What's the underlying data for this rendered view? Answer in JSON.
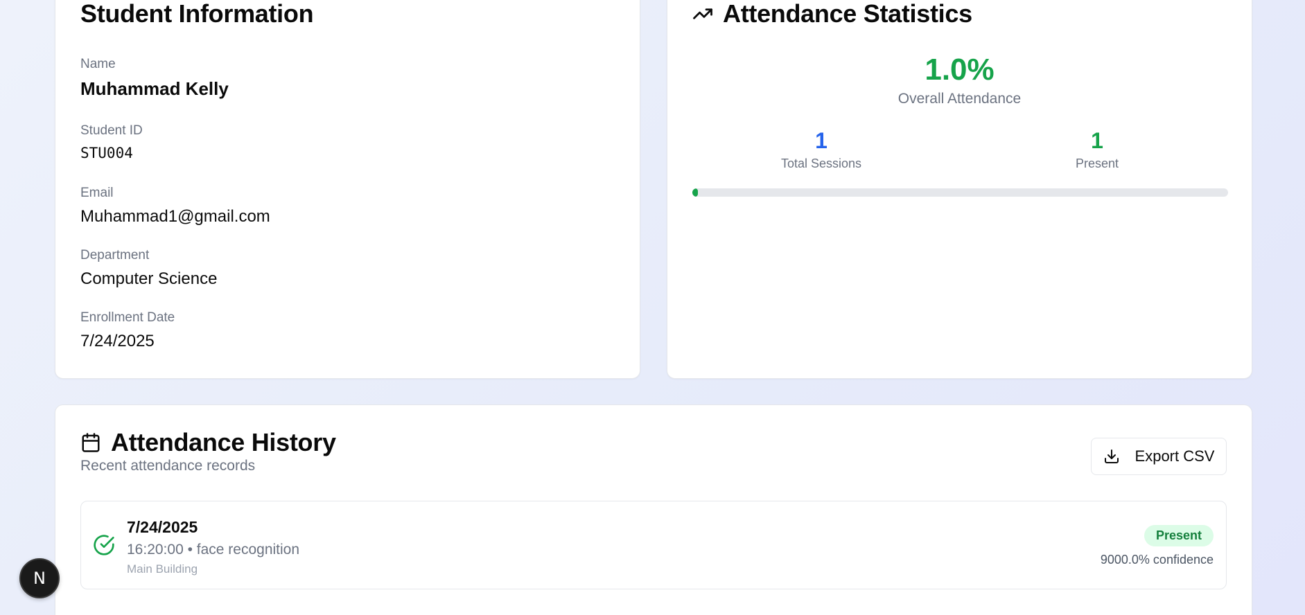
{
  "student_info": {
    "title": "Student Information",
    "name_label": "Name",
    "name": "Muhammad Kelly",
    "id_label": "Student ID",
    "id": "STU004",
    "email_label": "Email",
    "email": "Muhammad1@gmail.com",
    "department_label": "Department",
    "department": "Computer Science",
    "enrollment_label": "Enrollment Date",
    "enrollment_date": "7/24/2025"
  },
  "stats": {
    "title": "Attendance Statistics",
    "icon": "trending-up-icon",
    "overall_value": "1.0%",
    "overall_label": "Overall Attendance",
    "total_sessions": "1",
    "total_sessions_label": "Total Sessions",
    "present": "1",
    "present_label": "Present",
    "progress_percent": 1.0,
    "colors": {
      "green": "#16a34a",
      "blue": "#2563eb"
    }
  },
  "history": {
    "title": "Attendance History",
    "icon": "calendar-icon",
    "subtitle": "Recent attendance records",
    "export_label": "Export CSV",
    "export_icon": "download-icon",
    "records": [
      {
        "date": "7/24/2025",
        "time_method": "16:20:00 • face recognition",
        "location": "Main Building",
        "status": "Present",
        "confidence": "9000.0% confidence",
        "icon": "check-circle-icon"
      }
    ]
  },
  "overlay": {
    "badge_letter": "N"
  }
}
